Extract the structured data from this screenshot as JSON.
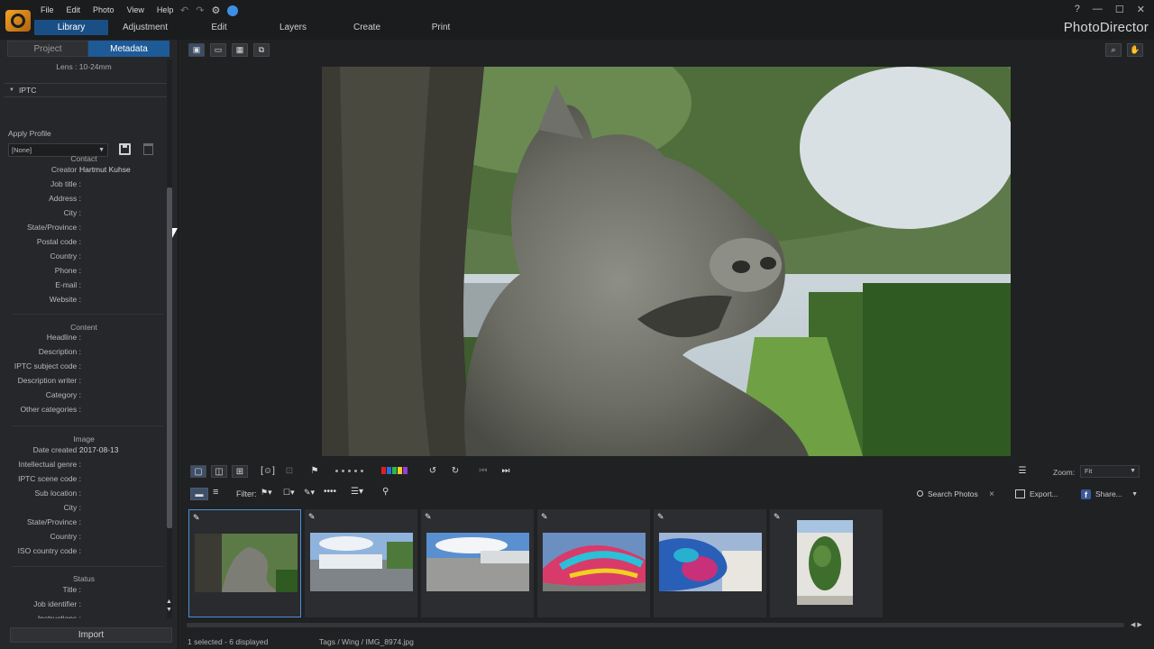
{
  "app": {
    "name": "PhotoDirector",
    "menu": [
      "File",
      "Edit",
      "Photo",
      "View",
      "Help"
    ],
    "modes": [
      "Library",
      "Adjustment",
      "Edit",
      "Layers",
      "Create",
      "Print"
    ],
    "active_mode": "Library",
    "window_controls": [
      "?",
      "—",
      "☐",
      "✕"
    ]
  },
  "left_panel": {
    "tabs": [
      "Project",
      "Metadata"
    ],
    "active_tab": "Metadata",
    "lens_row": "Lens : 10-24mm",
    "iptc_header": "IPTC",
    "apply_profile_label": "Apply Profile",
    "profile_value": "[None]",
    "contact": {
      "title": "Contact",
      "fields": [
        {
          "label": "Creator :",
          "value": "Hartmut Kuhse"
        },
        {
          "label": "Job title :",
          "value": ""
        },
        {
          "label": "Address :",
          "value": ""
        },
        {
          "label": "City :",
          "value": ""
        },
        {
          "label": "State/Province :",
          "value": ""
        },
        {
          "label": "Postal code :",
          "value": ""
        },
        {
          "label": "Country :",
          "value": ""
        },
        {
          "label": "Phone :",
          "value": ""
        },
        {
          "label": "E-mail :",
          "value": ""
        },
        {
          "label": "Website :",
          "value": ""
        }
      ]
    },
    "content": {
      "title": "Content",
      "fields": [
        {
          "label": "Headline :",
          "value": ""
        },
        {
          "label": "Description :",
          "value": ""
        },
        {
          "label": "IPTC subject code :",
          "value": ""
        },
        {
          "label": "Description writer :",
          "value": ""
        },
        {
          "label": "Category :",
          "value": ""
        },
        {
          "label": "Other categories :",
          "value": ""
        }
      ]
    },
    "image": {
      "title": "Image",
      "fields": [
        {
          "label": "Date created :",
          "value": "2017-08-13"
        },
        {
          "label": "Intellectual genre :",
          "value": ""
        },
        {
          "label": "IPTC scene code :",
          "value": ""
        },
        {
          "label": "Sub location :",
          "value": ""
        },
        {
          "label": "City :",
          "value": ""
        },
        {
          "label": "State/Province :",
          "value": ""
        },
        {
          "label": "Country :",
          "value": ""
        },
        {
          "label": "ISO country code :",
          "value": ""
        }
      ]
    },
    "status": {
      "title": "Status",
      "fields": [
        {
          "label": "Title :",
          "value": ""
        },
        {
          "label": "Job identifier :",
          "value": ""
        },
        {
          "label": "Instructions :",
          "value": ""
        }
      ]
    },
    "import_label": "Import"
  },
  "toolbar": {
    "zoom_label": "Zoom:",
    "zoom_value": "Fit",
    "filter_label": "Filter:",
    "search_label": "Search Photos",
    "export_label": "Export...",
    "share_label": "Share...",
    "color_labels": [
      "#e02020",
      "#2a6fe0",
      "#2bb84a",
      "#e8d020",
      "#9b3ad8"
    ]
  },
  "filmstrip": {
    "count": 6,
    "selected_index": 0
  },
  "status": {
    "selection": "1 selected - 6 displayed",
    "path": "Tags / Wing / IMG_8974.jpg"
  }
}
